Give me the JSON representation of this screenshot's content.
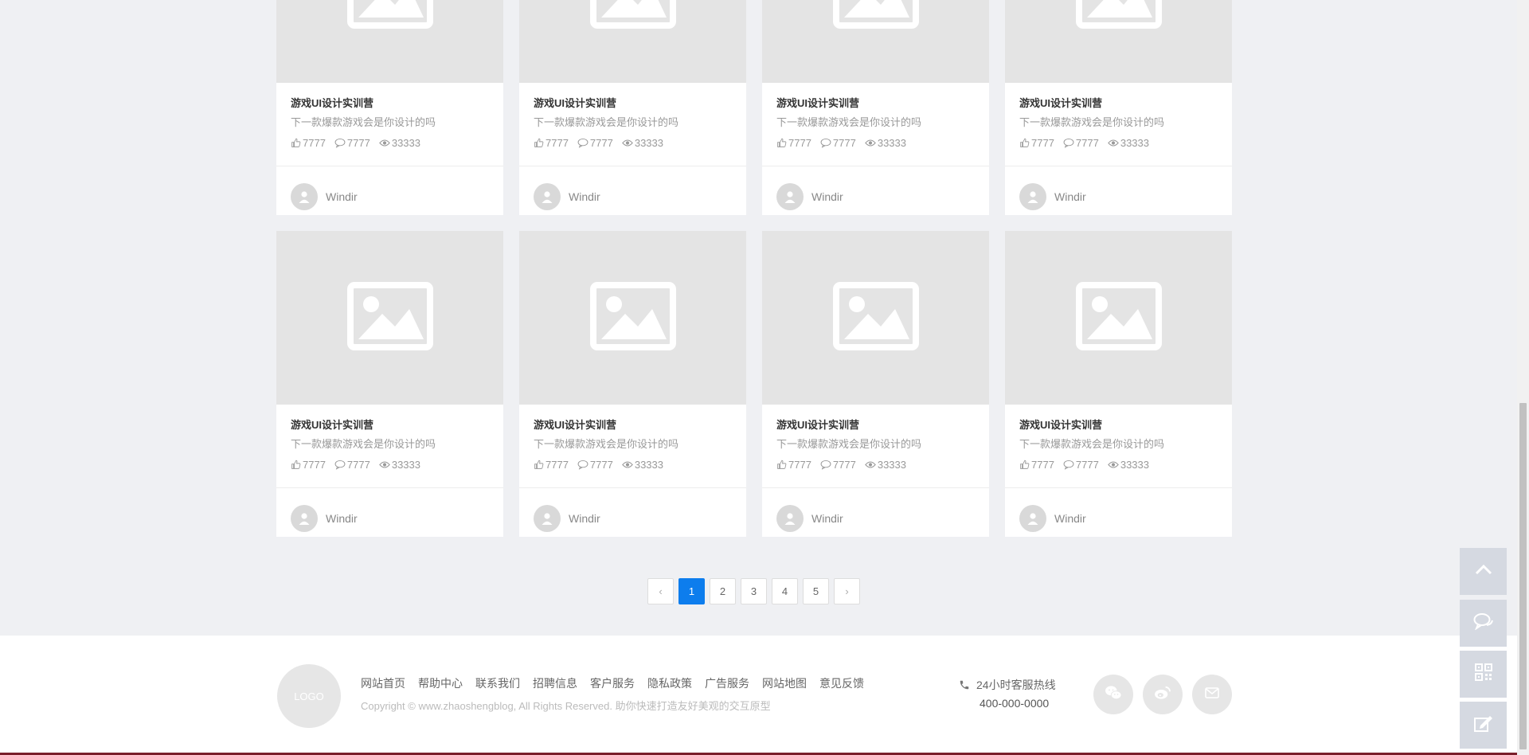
{
  "cards": [
    {
      "title": "游戏UI设计实训营",
      "desc": "下一款爆款游戏会是你设计的吗",
      "likes": "7777",
      "comments": "7777",
      "views": "33333",
      "author": "Windir"
    },
    {
      "title": "游戏UI设计实训营",
      "desc": "下一款爆款游戏会是你设计的吗",
      "likes": "7777",
      "comments": "7777",
      "views": "33333",
      "author": "Windir"
    },
    {
      "title": "游戏UI设计实训营",
      "desc": "下一款爆款游戏会是你设计的吗",
      "likes": "7777",
      "comments": "7777",
      "views": "33333",
      "author": "Windir"
    },
    {
      "title": "游戏UI设计实训营",
      "desc": "下一款爆款游戏会是你设计的吗",
      "likes": "7777",
      "comments": "7777",
      "views": "33333",
      "author": "Windir"
    },
    {
      "title": "游戏UI设计实训营",
      "desc": "下一款爆款游戏会是你设计的吗",
      "likes": "7777",
      "comments": "7777",
      "views": "33333",
      "author": "Windir"
    },
    {
      "title": "游戏UI设计实训营",
      "desc": "下一款爆款游戏会是你设计的吗",
      "likes": "7777",
      "comments": "7777",
      "views": "33333",
      "author": "Windir"
    },
    {
      "title": "游戏UI设计实训营",
      "desc": "下一款爆款游戏会是你设计的吗",
      "likes": "7777",
      "comments": "7777",
      "views": "33333",
      "author": "Windir"
    },
    {
      "title": "游戏UI设计实训营",
      "desc": "下一款爆款游戏会是你设计的吗",
      "likes": "7777",
      "comments": "7777",
      "views": "33333",
      "author": "Windir"
    }
  ],
  "pagination": {
    "prev": "‹",
    "next": "›",
    "pages": [
      "1",
      "2",
      "3",
      "4",
      "5"
    ],
    "current": "1"
  },
  "footer": {
    "logo": "LOGO",
    "links": [
      "网站首页",
      "帮助中心",
      "联系我们",
      "招聘信息",
      "客户服务",
      "隐私政策",
      "广告服务",
      "网站地图",
      "意见反馈"
    ],
    "copyright": "Copyright © www.zhaoshengblog, All Rights Reserved. 助你快速打造友好美观的交互原型",
    "hotline_label": "24小时客服热线",
    "hotline_number": "400-000-0000",
    "social_icons": [
      "wechat-icon",
      "weibo-icon",
      "mail-icon"
    ]
  },
  "side_toolbar": [
    "back-to-top-icon",
    "chat-icon",
    "qrcode-icon",
    "edit-icon"
  ],
  "colors": {
    "accent": "#0d7ded",
    "page_bg": "#eff0f3",
    "placeholder_bg": "#e4e4e4",
    "side_button_bg": "#d5d9e1"
  }
}
